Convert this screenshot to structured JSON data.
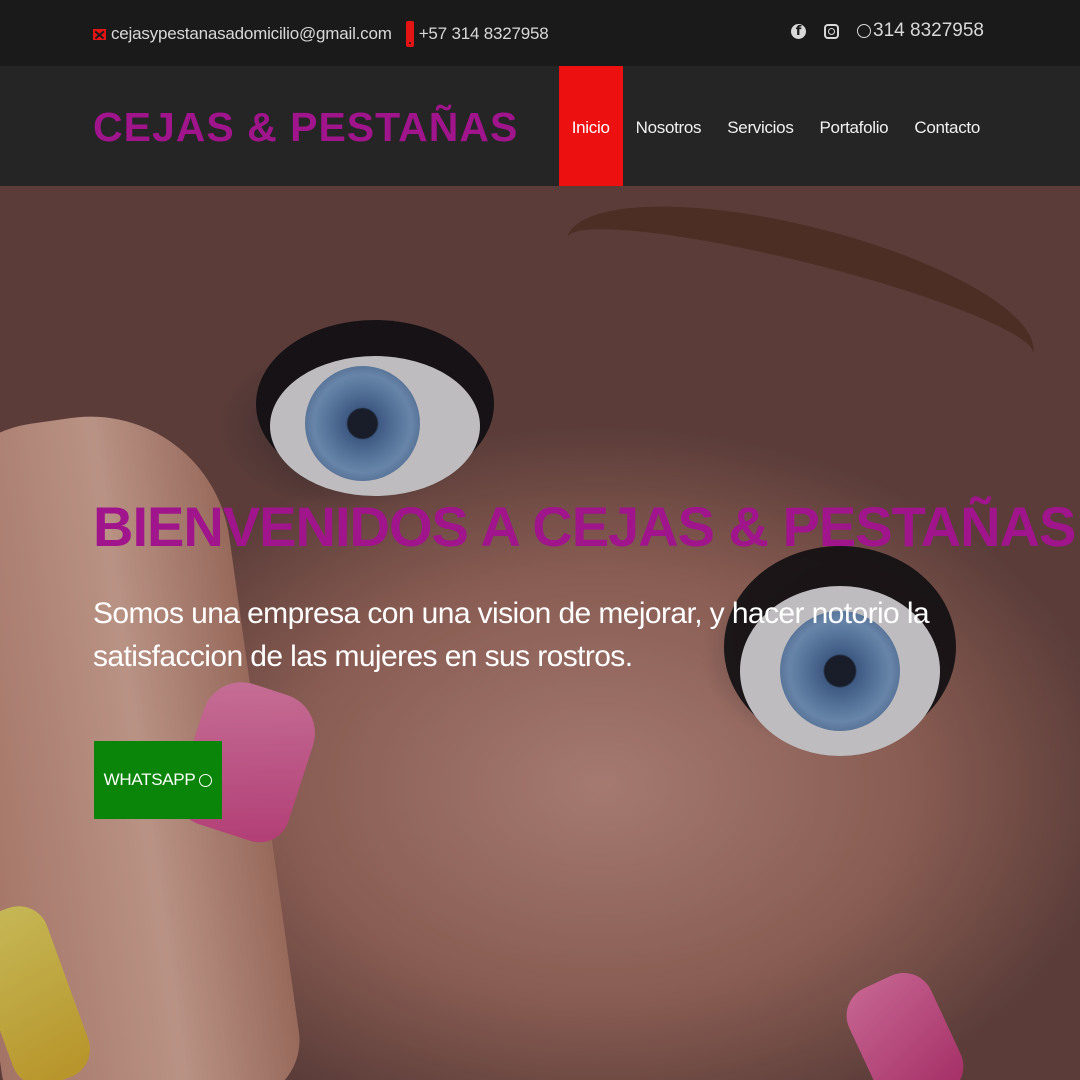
{
  "topbar": {
    "email": "cejasypestanasadomicilio@gmail.com",
    "phone": "+57 314 8327958",
    "whatsapp": "314 8327958",
    "icons": {
      "mail": "mail-icon",
      "phone": "phone-icon",
      "facebook": "facebook-icon",
      "instagram": "instagram-icon",
      "whatsapp": "whatsapp-icon"
    }
  },
  "navbar": {
    "brand": "CEJAS & PESTAÑAS",
    "menu": [
      {
        "label": "Inicio",
        "active": true
      },
      {
        "label": "Nosotros",
        "active": false
      },
      {
        "label": "Servicios",
        "active": false
      },
      {
        "label": "Portafolio",
        "active": false
      },
      {
        "label": "Contacto",
        "active": false
      }
    ]
  },
  "hero": {
    "title": "BIENVENIDOS A CEJAS & PESTAÑAS COLOMBIA",
    "text": "Somos una empresa con una vision de mejorar, y hacer notorio la satisfaccion de las mujeres en sus rostros.",
    "button_label": "WHATSAPP"
  },
  "colors": {
    "brand": "#a0148c",
    "active_nav": "#ec1010",
    "whatsapp_button": "#0a850a",
    "topbar": "#1a1a1a",
    "navbar": "#252525"
  }
}
